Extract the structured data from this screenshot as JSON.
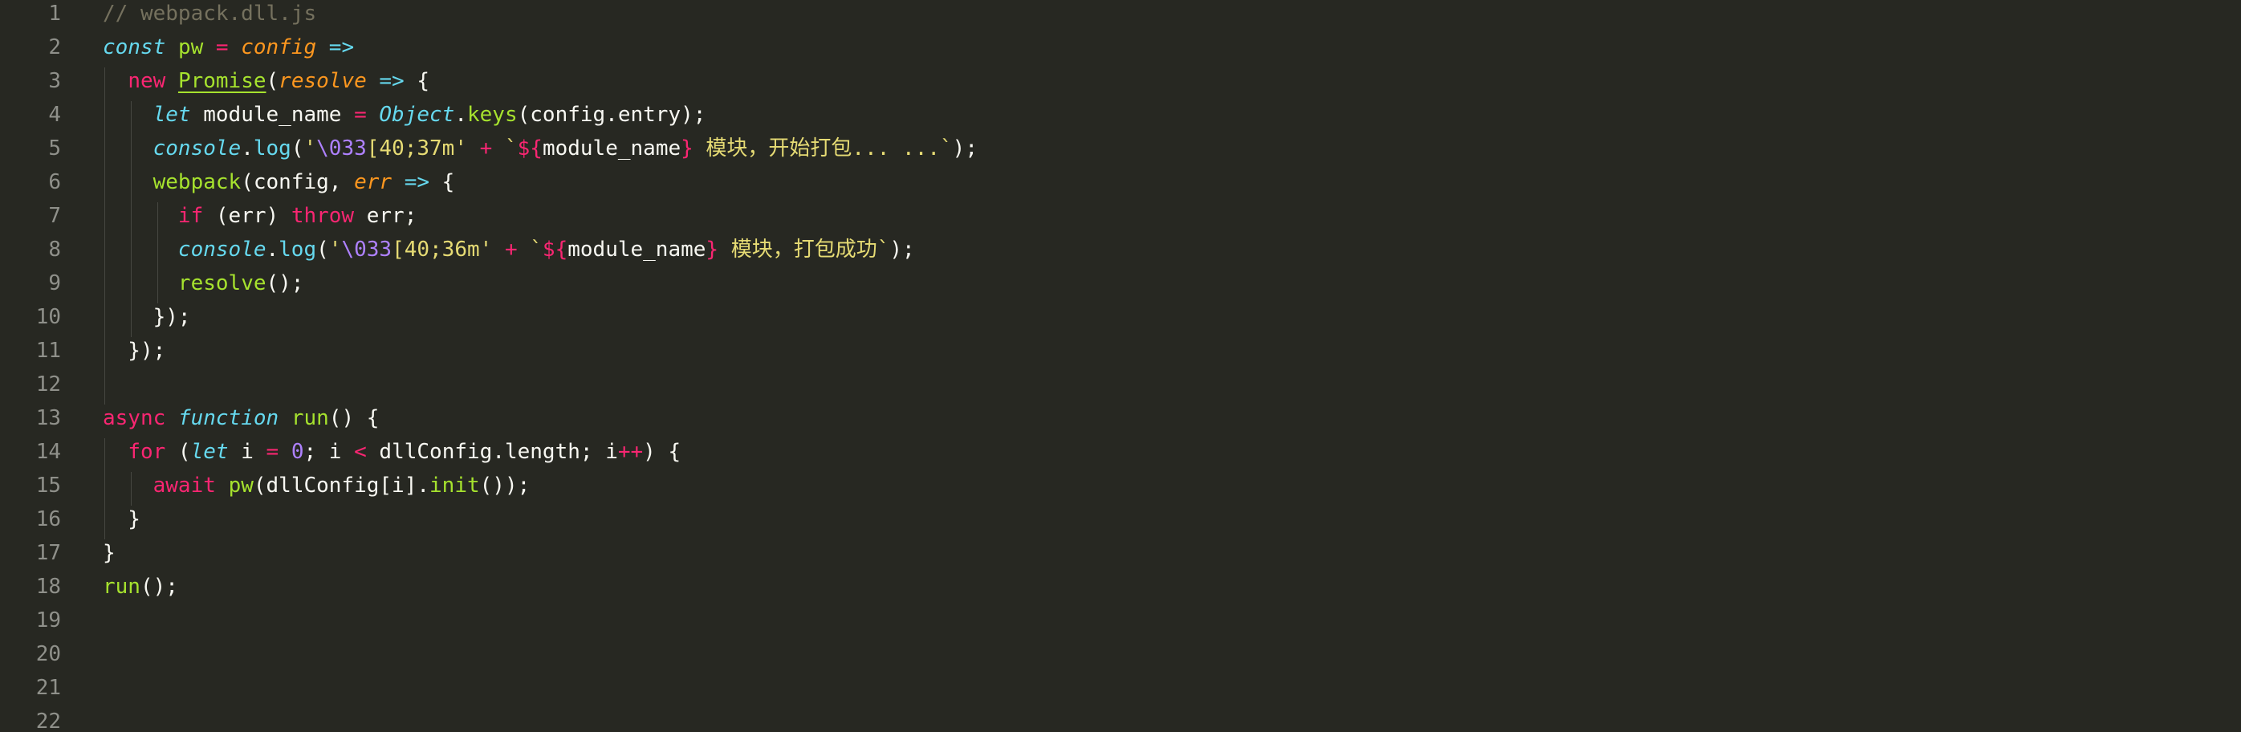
{
  "editor": {
    "file_comment": "// webpack.dll.js",
    "line_numbers": [
      "1",
      "2",
      "3",
      "4",
      "5",
      "6",
      "7",
      "8",
      "9",
      "10",
      "11",
      "12",
      "13",
      "14",
      "15",
      "16",
      "17",
      "18",
      "19",
      "20",
      "21",
      "22"
    ],
    "lines": [
      [
        {
          "t": "// webpack.dll.js",
          "c": "c"
        }
      ],
      [
        {
          "t": "const",
          "c": "b"
        },
        {
          "t": " "
        },
        {
          "t": "pw",
          "c": "f"
        },
        {
          "t": " "
        },
        {
          "t": "=",
          "c": "k"
        },
        {
          "t": " "
        },
        {
          "t": "config",
          "c": "p"
        },
        {
          "t": " "
        },
        {
          "t": "=>",
          "c": "bi"
        }
      ],
      [
        {
          "t": "  "
        },
        {
          "t": "new",
          "c": "k"
        },
        {
          "t": " "
        },
        {
          "t": "Promise",
          "c": "f u"
        },
        {
          "t": "("
        },
        {
          "t": "resolve",
          "c": "p"
        },
        {
          "t": " "
        },
        {
          "t": "=>",
          "c": "bi"
        },
        {
          "t": " {"
        }
      ],
      [
        {
          "t": "    "
        },
        {
          "t": "let",
          "c": "b"
        },
        {
          "t": " module_name "
        },
        {
          "t": "=",
          "c": "k"
        },
        {
          "t": " "
        },
        {
          "t": "Object",
          "c": "b"
        },
        {
          "t": "."
        },
        {
          "t": "keys",
          "c": "f"
        },
        {
          "t": "(config.entry);"
        }
      ],
      [
        {
          "t": "    "
        },
        {
          "t": "console",
          "c": "b"
        },
        {
          "t": "."
        },
        {
          "t": "log",
          "c": "bi"
        },
        {
          "t": "("
        },
        {
          "t": "'",
          "c": "s"
        },
        {
          "t": "\\033",
          "c": "n"
        },
        {
          "t": "[40;37m'",
          "c": "s"
        },
        {
          "t": " "
        },
        {
          "t": "+",
          "c": "k"
        },
        {
          "t": " "
        },
        {
          "t": "`",
          "c": "s"
        },
        {
          "t": "${",
          "c": "k"
        },
        {
          "t": "module_name"
        },
        {
          "t": "}",
          "c": "k"
        },
        {
          "t": " 模块，开始打包... ...`",
          "c": "s"
        },
        {
          "t": ");"
        }
      ],
      [
        {
          "t": "    "
        },
        {
          "t": "webpack",
          "c": "f"
        },
        {
          "t": "(config, "
        },
        {
          "t": "err",
          "c": "p"
        },
        {
          "t": " "
        },
        {
          "t": "=>",
          "c": "bi"
        },
        {
          "t": " {"
        }
      ],
      [
        {
          "t": "      "
        },
        {
          "t": "if",
          "c": "k"
        },
        {
          "t": " (err) "
        },
        {
          "t": "throw",
          "c": "k"
        },
        {
          "t": " err;"
        }
      ],
      [
        {
          "t": "      "
        },
        {
          "t": "console",
          "c": "b"
        },
        {
          "t": "."
        },
        {
          "t": "log",
          "c": "bi"
        },
        {
          "t": "("
        },
        {
          "t": "'",
          "c": "s"
        },
        {
          "t": "\\033",
          "c": "n"
        },
        {
          "t": "[40;36m'",
          "c": "s"
        },
        {
          "t": " "
        },
        {
          "t": "+",
          "c": "k"
        },
        {
          "t": " "
        },
        {
          "t": "`",
          "c": "s"
        },
        {
          "t": "${",
          "c": "k"
        },
        {
          "t": "module_name"
        },
        {
          "t": "}",
          "c": "k"
        },
        {
          "t": " 模块，打包成功`",
          "c": "s"
        },
        {
          "t": ");"
        }
      ],
      [
        {
          "t": "      "
        },
        {
          "t": "resolve",
          "c": "f"
        },
        {
          "t": "();"
        }
      ],
      [
        {
          "t": "    });"
        }
      ],
      [
        {
          "t": "  });"
        }
      ],
      [
        {
          "t": ""
        }
      ],
      [
        {
          "t": "async",
          "c": "k"
        },
        {
          "t": " "
        },
        {
          "t": "function",
          "c": "b"
        },
        {
          "t": " "
        },
        {
          "t": "run",
          "c": "f"
        },
        {
          "t": "() {"
        }
      ],
      [
        {
          "t": "  "
        },
        {
          "t": "for",
          "c": "k"
        },
        {
          "t": " ("
        },
        {
          "t": "let",
          "c": "b"
        },
        {
          "t": " i "
        },
        {
          "t": "=",
          "c": "k"
        },
        {
          "t": " "
        },
        {
          "t": "0",
          "c": "n"
        },
        {
          "t": "; i "
        },
        {
          "t": "<",
          "c": "k"
        },
        {
          "t": " dllConfig.length; i"
        },
        {
          "t": "++",
          "c": "k"
        },
        {
          "t": ") {"
        }
      ],
      [
        {
          "t": "    "
        },
        {
          "t": "await",
          "c": "k"
        },
        {
          "t": " "
        },
        {
          "t": "pw",
          "c": "f"
        },
        {
          "t": "(dllConfig[i]."
        },
        {
          "t": "init",
          "c": "f"
        },
        {
          "t": "());"
        }
      ],
      [
        {
          "t": "  }"
        }
      ],
      [
        {
          "t": "}"
        }
      ],
      [
        {
          "t": "run",
          "c": "f"
        },
        {
          "t": "();"
        }
      ],
      [
        {
          "t": ""
        }
      ],
      [
        {
          "t": ""
        }
      ],
      [
        {
          "t": ""
        }
      ],
      [
        {
          "t": ""
        }
      ]
    ]
  },
  "colors": {
    "background": "#272822",
    "foreground": "#f8f8f2",
    "gutter_text": "#8f908a",
    "keyword": "#f92672",
    "string": "#e6db74",
    "number": "#ae81ff",
    "function": "#a6e22e",
    "storage": "#66d9ef",
    "parameter": "#fd971f",
    "comment": "#75715e"
  }
}
